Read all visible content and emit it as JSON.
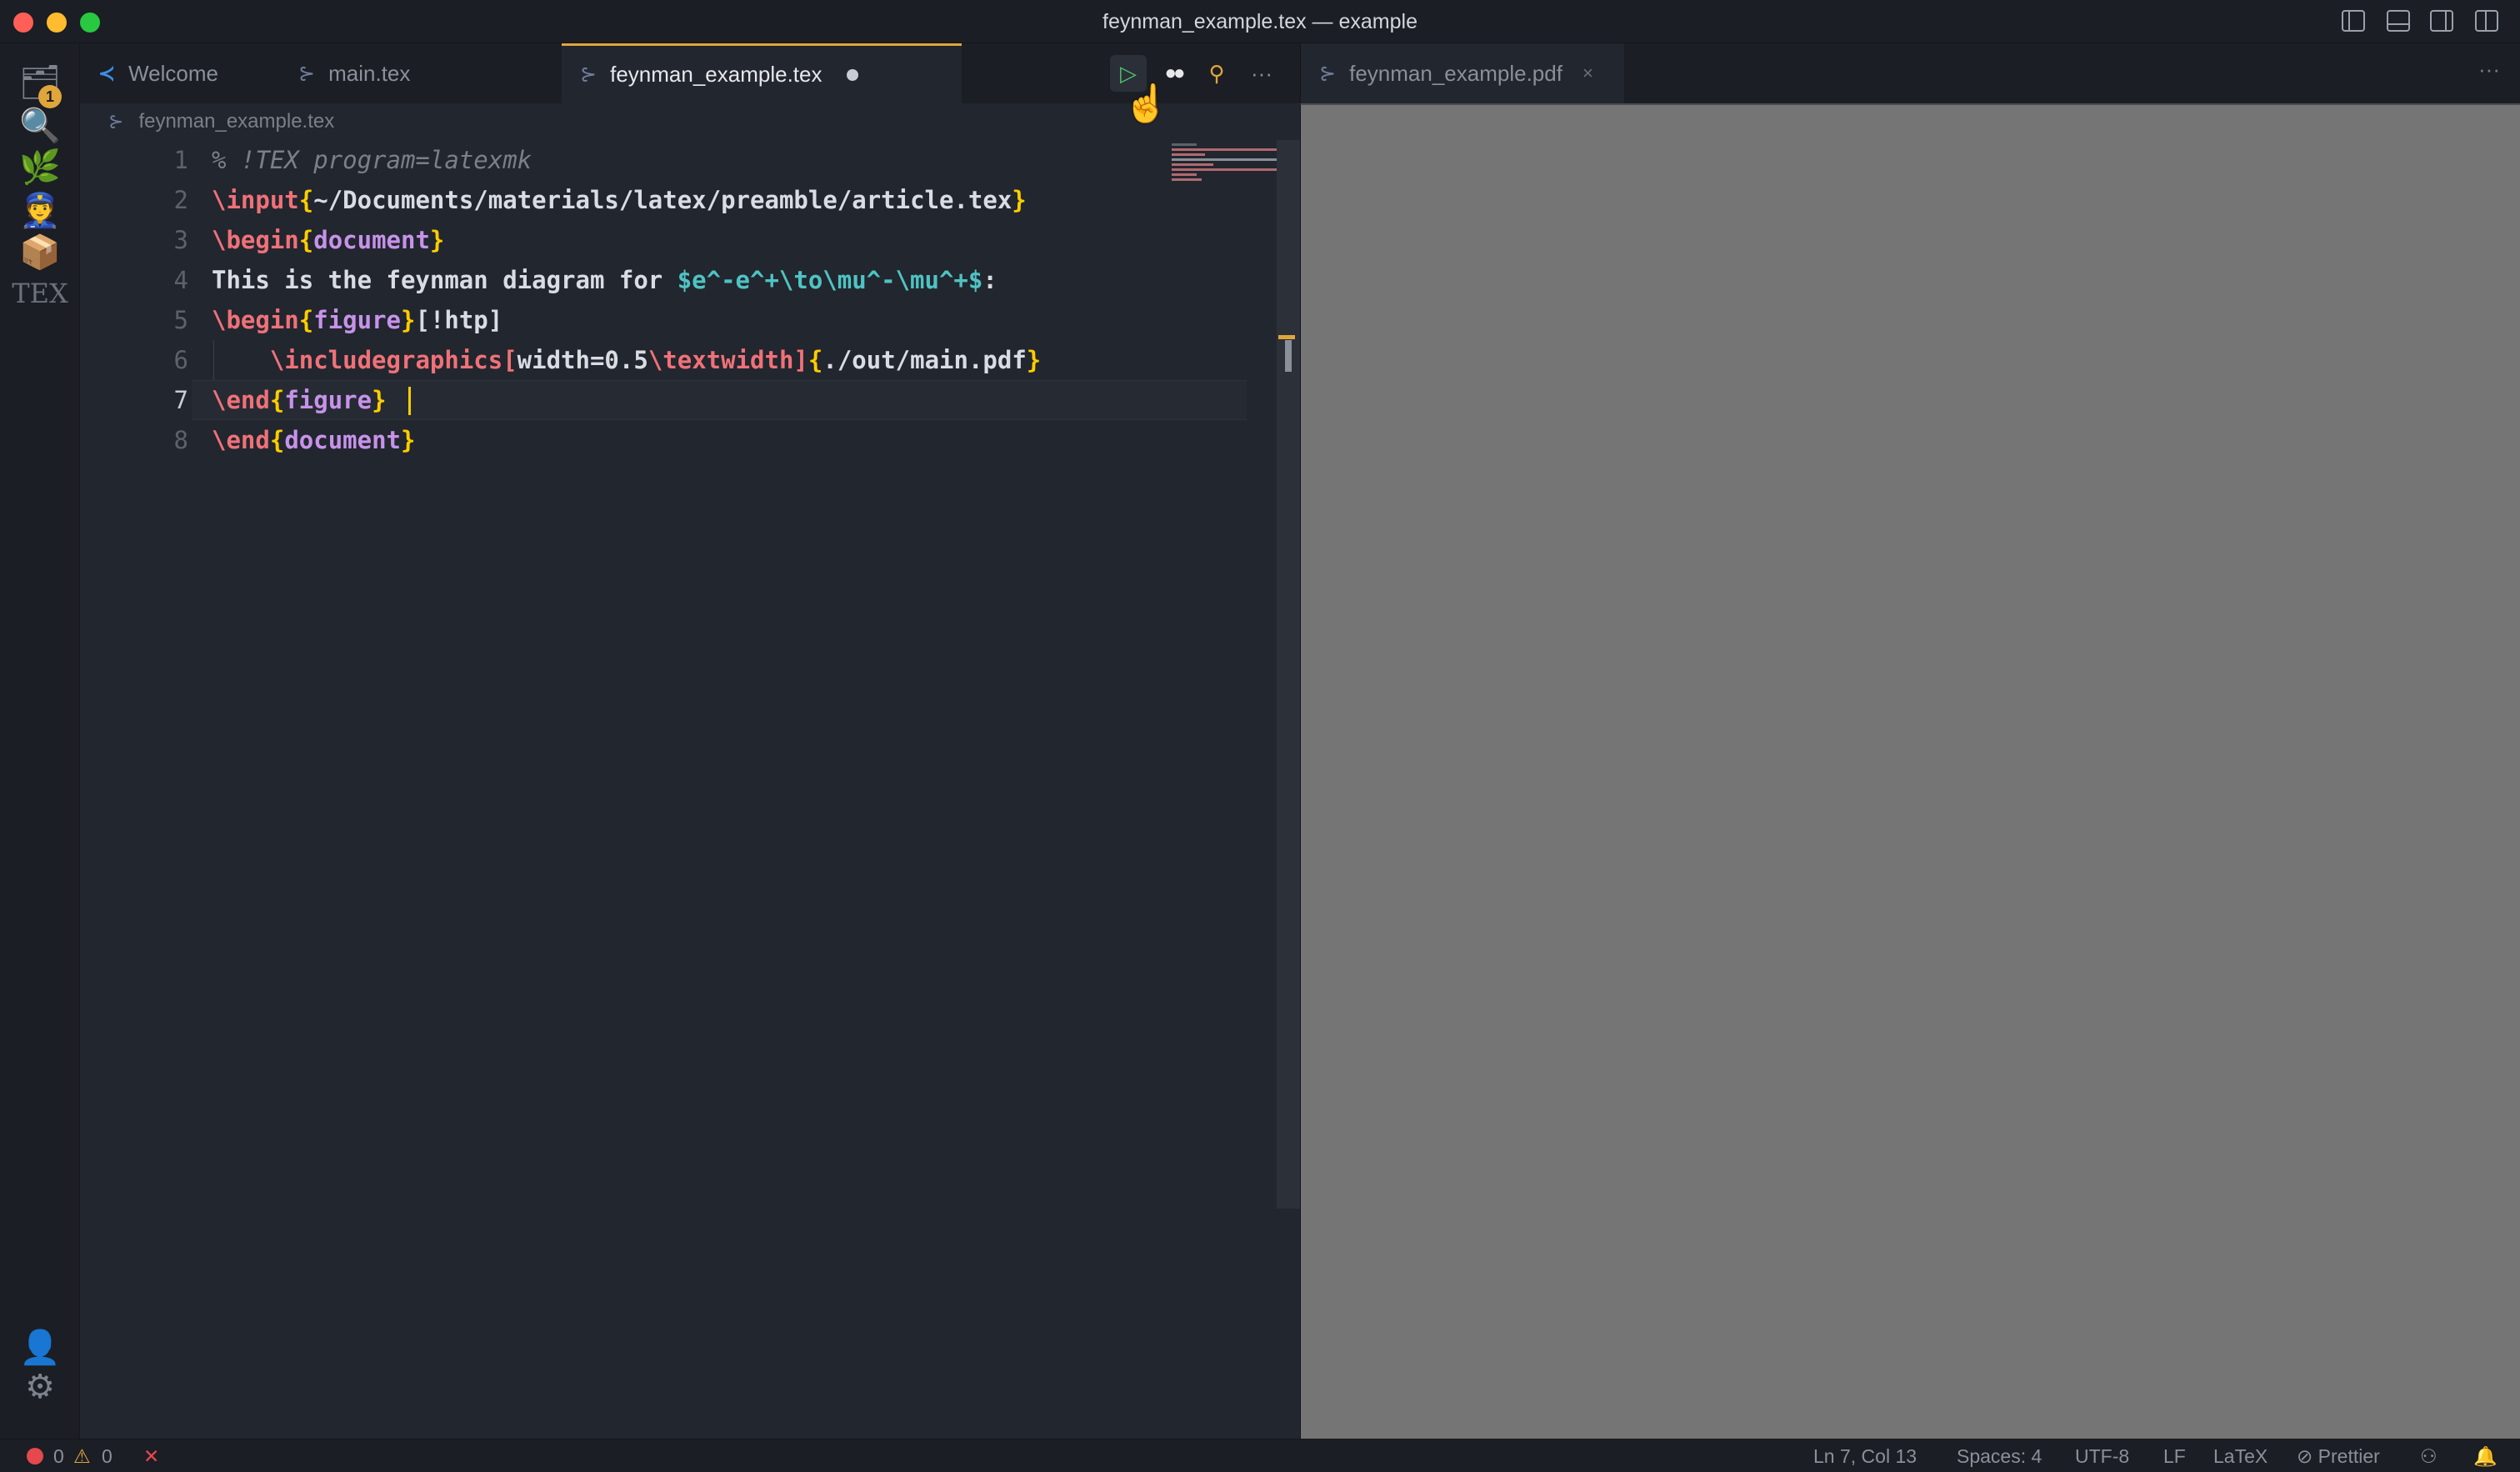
{
  "window": {
    "title": "feynman_example.tex — example"
  },
  "activity_bar": {
    "explorer_badge": "1",
    "tex_label": "TEX"
  },
  "tabs": [
    {
      "label": "Welcome"
    },
    {
      "label": "main.tex"
    },
    {
      "label": "feynman_example.tex",
      "active": true,
      "dirty": true
    }
  ],
  "toolbar": {
    "run": "▷",
    "more": "···"
  },
  "breadcrumb": "feynman_example.tex",
  "editor": {
    "line_numbers": [
      "1",
      "2",
      "3",
      "4",
      "5",
      "6",
      "7",
      "8"
    ],
    "current_line": 7,
    "lines": [
      [
        {
          "t": "% !TEX program=latexmk",
          "c": "cmt"
        }
      ],
      [
        {
          "t": "\\input",
          "c": "cmd"
        },
        {
          "t": "{",
          "c": "brace"
        },
        {
          "t": "~/Documents/materials/latex/preamble/article.tex",
          "c": "path"
        },
        {
          "t": "}",
          "c": "brace"
        }
      ],
      [
        {
          "t": "\\begin",
          "c": "cmd"
        },
        {
          "t": "{",
          "c": "brace"
        },
        {
          "t": "document",
          "c": "env"
        },
        {
          "t": "}",
          "c": "brace"
        }
      ],
      [
        {
          "t": "This is the feynman diagram for ",
          "c": "plain"
        },
        {
          "t": "$e^-e^+\\to\\mu^-\\mu^+$",
          "c": "math"
        },
        {
          "t": ":",
          "c": "plain"
        }
      ],
      [
        {
          "t": "\\begin",
          "c": "cmd"
        },
        {
          "t": "{",
          "c": "brace"
        },
        {
          "t": "figure",
          "c": "env"
        },
        {
          "t": "}",
          "c": "brace"
        },
        {
          "t": "[!htp]",
          "c": "plain"
        }
      ],
      [
        {
          "t": "    ",
          "c": "plain"
        },
        {
          "t": "\\includegraphics",
          "c": "cmd"
        },
        {
          "t": "[",
          "c": "bracket"
        },
        {
          "t": "width=0.5",
          "c": "opt"
        },
        {
          "t": "\\textwidth",
          "c": "cmd"
        },
        {
          "t": "]",
          "c": "bracket"
        },
        {
          "t": "{",
          "c": "brace"
        },
        {
          "t": "./out/main.pdf",
          "c": "path"
        },
        {
          "t": "}",
          "c": "brace"
        }
      ],
      [
        {
          "t": "\\end",
          "c": "cmd"
        },
        {
          "t": "{",
          "c": "brace"
        },
        {
          "t": "figure",
          "c": "env"
        },
        {
          "t": "}",
          "c": "brace"
        }
      ],
      [
        {
          "t": "\\end",
          "c": "cmd"
        },
        {
          "t": "{",
          "c": "brace"
        },
        {
          "t": "document",
          "c": "env"
        },
        {
          "t": "}",
          "c": "brace"
        }
      ]
    ]
  },
  "pdf_tab": {
    "label": "feynman_example.pdf",
    "close": "×",
    "more": "···"
  },
  "status_bar": {
    "errors": "0",
    "warnings": "0",
    "position": "Ln 7, Col 13",
    "spaces": "Spaces: 4",
    "encoding": "UTF-8",
    "eol": "LF",
    "language": "LaTeX",
    "formatter": "Prettier"
  },
  "colors": {
    "accent": "#e0a53b",
    "run": "#4ec26a",
    "error": "#e5484d",
    "pdf_background": "#757575"
  }
}
